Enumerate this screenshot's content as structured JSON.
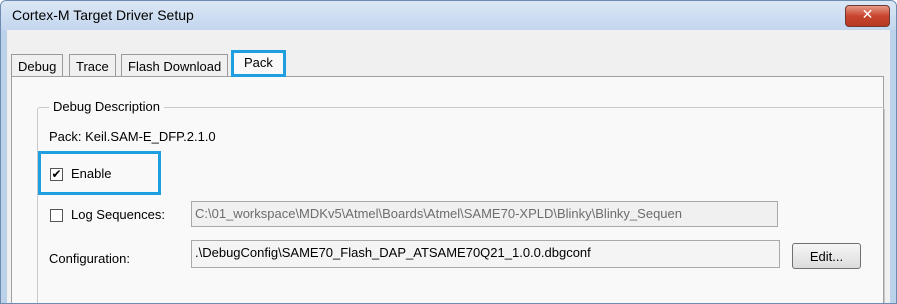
{
  "window": {
    "title": "Cortex-M Target Driver Setup",
    "close_label": "✕"
  },
  "tabs": [
    {
      "label": "Debug"
    },
    {
      "label": "Trace"
    },
    {
      "label": "Flash Download"
    },
    {
      "label": "Pack",
      "active": true
    }
  ],
  "debug_description": {
    "group_title": "Debug Description",
    "pack_label": "Pack: Keil.SAM-E_DFP.2.1.0",
    "enable": {
      "label": "Enable",
      "checked": true,
      "mark": "✔"
    },
    "log_sequences": {
      "label": "Log Sequences:",
      "checked": false,
      "path": "C:\\01_workspace\\MDKv5\\Atmel\\Boards\\Atmel\\SAME70-XPLD\\Blinky\\Blinky_Sequen"
    },
    "configuration": {
      "label": "Configuration:",
      "value": ".\\DebugConfig\\SAME70_Flash_DAP_ATSAME70Q21_1.0.0.dbgconf",
      "edit_label": "Edit..."
    }
  },
  "colors": {
    "highlight": "#1f9ee0",
    "close_button": "#c7452f"
  }
}
